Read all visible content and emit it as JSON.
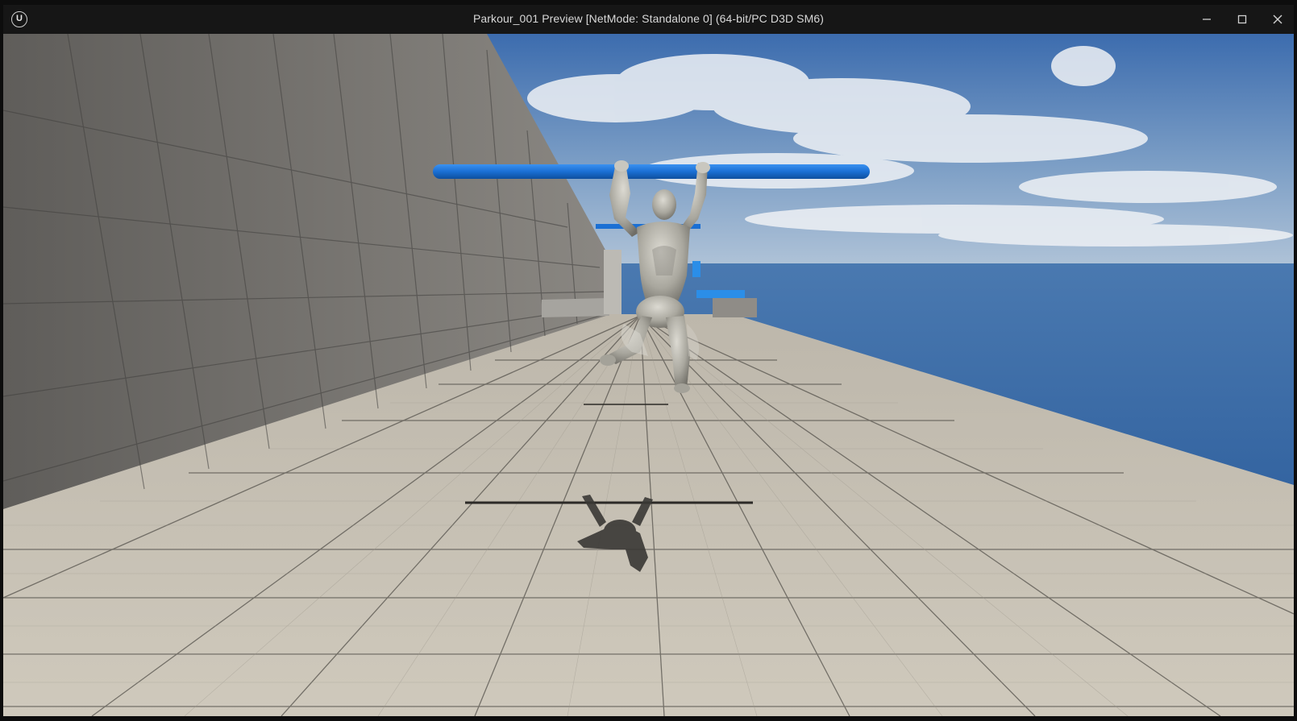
{
  "window": {
    "logo_text": "U",
    "title": "Parkour_001 Preview [NetMode: Standalone 0]  (64-bit/PC D3D SM6)",
    "controls": {
      "minimize_icon": "minimize-icon",
      "maximize_icon": "maximize-icon",
      "close_icon": "close-icon"
    }
  },
  "scene": {
    "colors": {
      "sky_top": "#3d6fb0",
      "sky_horizon": "#a9bfd6",
      "ocean": "#2f5f9c",
      "floor": "#c8c2b5",
      "wall": "#6f6d6a",
      "bar": "#1a73d6",
      "mannequin": "#b8b6ad"
    }
  }
}
